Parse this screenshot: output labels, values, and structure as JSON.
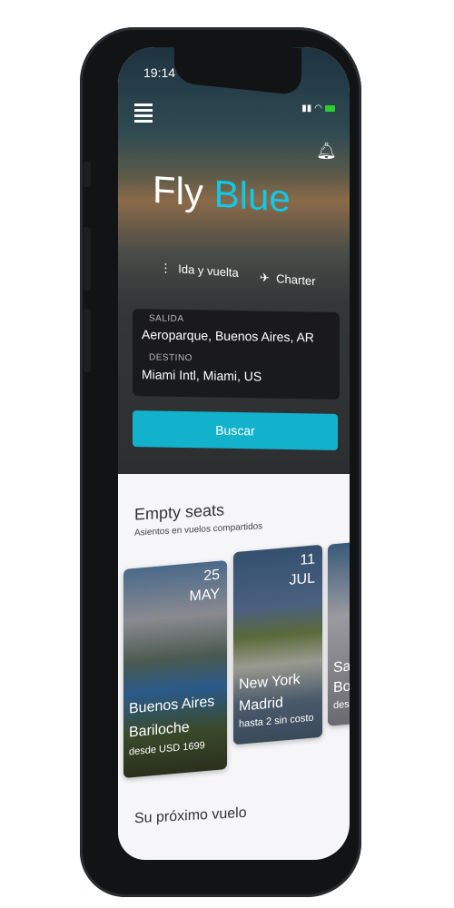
{
  "status_bar": {
    "time": "19:14"
  },
  "header": {
    "logo_first": "Fly",
    "logo_second": "Blue"
  },
  "trip_options": [
    {
      "label": "Ida y vuelta",
      "icon": "more-vert-icon"
    },
    {
      "label": "Charter",
      "icon": "airplane-icon"
    }
  ],
  "form": {
    "departure_label": "SALIDA",
    "departure_value": "Aeroparque, Buenos Aires, AR",
    "destination_label": "DESTINO",
    "destination_value": "Miami Intl, Miami, US"
  },
  "search_button": "Buscar",
  "empty_seats": {
    "title": "Empty seats",
    "subtitle": "Asientos en vuelos compartidos",
    "cards": [
      {
        "day": "25",
        "month": "MAY",
        "origin": "Buenos Aires",
        "destination": "Bariloche",
        "detail": "desde USD 1699"
      },
      {
        "day": "11",
        "month": "JUL",
        "origin": "New York",
        "destination": "Madrid",
        "detail": "hasta 2 sin costo"
      },
      {
        "origin": "San",
        "destination": "Bog",
        "detail": "desd"
      }
    ]
  },
  "next_flight": {
    "title": "Su próximo vuelo"
  },
  "colors": {
    "accent": "#10c8e8",
    "button": "#12b2cc"
  }
}
